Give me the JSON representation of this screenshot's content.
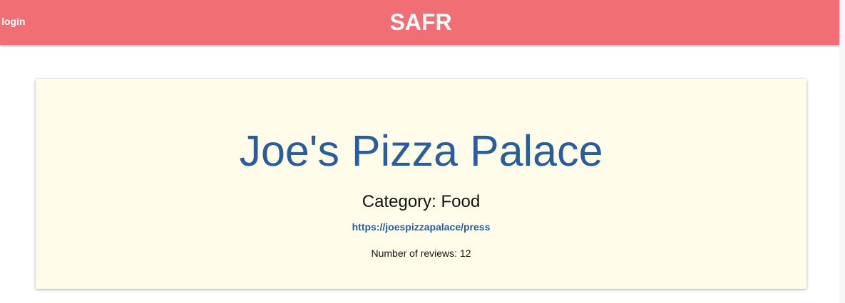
{
  "header": {
    "login_label": "login",
    "title": "SAFR"
  },
  "business": {
    "name": "Joe's Pizza Palace",
    "category_prefix": "Category: ",
    "category": "Food",
    "press_link": "https://joespizzapalace/press",
    "reviews_prefix": "Number of reviews: ",
    "reviews_count": "12"
  },
  "colors": {
    "header_bg": "#f06e74",
    "card_bg": "#fffde9",
    "accent_blue": "#2b5c9d"
  }
}
